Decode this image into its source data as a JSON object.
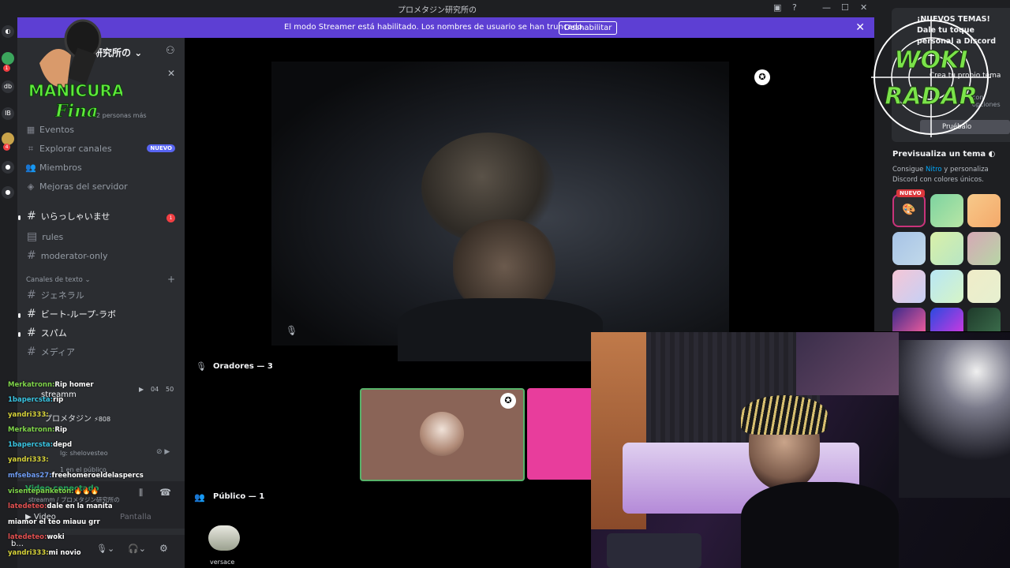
{
  "window": {
    "title": "プロメタジン研究所の"
  },
  "banner": {
    "message": "El modo Streamer está habilitado. Los nombres de usuario se han truncado.",
    "disable_button": "Deshabilitar"
  },
  "sidebar": {
    "server_name": "研究所の",
    "logo_text": [
      "MANICURA",
      "Fina"
    ],
    "members_preview": "2 personas más",
    "nav": [
      {
        "label": "Eventos",
        "icon": "calendar-icon"
      },
      {
        "label": "Explorar canales",
        "icon": "explore-icon",
        "badge": "NUEVO"
      },
      {
        "label": "Miembros",
        "icon": "members-icon"
      },
      {
        "label": "Mejoras del servidor",
        "icon": "boost-icon"
      }
    ],
    "channels_top": [
      {
        "name": "いらっしゃいませ",
        "unread": "1"
      },
      {
        "name": "rules"
      },
      {
        "name": "moderator-only"
      }
    ],
    "category": "Canales de texto",
    "channels_text": [
      {
        "name": "ジェネラル"
      },
      {
        "name": "ビート-ループ-ラボ"
      },
      {
        "name": "スパム"
      },
      {
        "name": "メディア"
      }
    ],
    "voice": {
      "channel": "streamm",
      "count_a": "04",
      "count_b": "50",
      "user": "プロメタジン",
      "boost": "808",
      "user_status": "lg: shelovesteo",
      "audience": "1 en el público",
      "connected": "Video conectado",
      "path": "streamm / プロメタジン研究所の",
      "video_button": "Video",
      "screen_button": "Pantalla"
    },
    "footer_user": "b..."
  },
  "chat": [
    {
      "user": "Merkatronn:",
      "text": "Rip homer",
      "color": "#7fd44a"
    },
    {
      "user": "1bapercsta:",
      "text": "rip",
      "color": "#39c3e0"
    },
    {
      "user": "yandri333:",
      "text": "",
      "color": "#d6d23a"
    },
    {
      "user": "Merkatronn:",
      "text": "Rip",
      "color": "#7fd44a"
    },
    {
      "user": "1bapercsta:",
      "text": "depd",
      "color": "#39c3e0"
    },
    {
      "user": "yandri333:",
      "text": "",
      "color": "#d6d23a"
    },
    {
      "user": "mfsebas27:",
      "text": "freehomeroeldelaspercs",
      "color": "#6f9cf2"
    },
    {
      "user": "visentepanketon:",
      "text": "🔥🔥🔥",
      "color": "#7fd44a"
    },
    {
      "user": "latedeteo:",
      "text": "dale en la manita",
      "color": "#e05050"
    },
    {
      "user": "",
      "text": "miamor el teo miauu grr",
      "color": "#e05050"
    },
    {
      "user": "latedeteo:",
      "text": "woki",
      "color": "#e05050"
    },
    {
      "user": "yandri333:",
      "text": "mi novio",
      "color": "#d6d23a"
    }
  ],
  "stage": {
    "speakers_label": "Oradores — 3",
    "audience_label": "Público — 1",
    "audience_member": "versace"
  },
  "theme_panel": {
    "promo_title": "¡NUEVOS TEMAS! Dale tu toque personal a Discord",
    "create_theme": "Crea tu propio tema",
    "desc": "con opciones",
    "try_button": "Pruébalo",
    "preview_title": "Previsualiza un tema",
    "preview_desc_pre": "Consigue",
    "nitro": "Nitro",
    "preview_desc_post": "y personaliza Discord con colores únicos.",
    "new_badge": "NUEVO"
  },
  "overlay": {
    "radar_text": [
      "WOKI",
      "RADAR"
    ]
  },
  "colors": {
    "accent": "#5865f2",
    "banner": "#5d3fd3",
    "danger": "#f23f43",
    "speaker_tile": "#8a6457",
    "pink_tile": "#e83d9c"
  }
}
